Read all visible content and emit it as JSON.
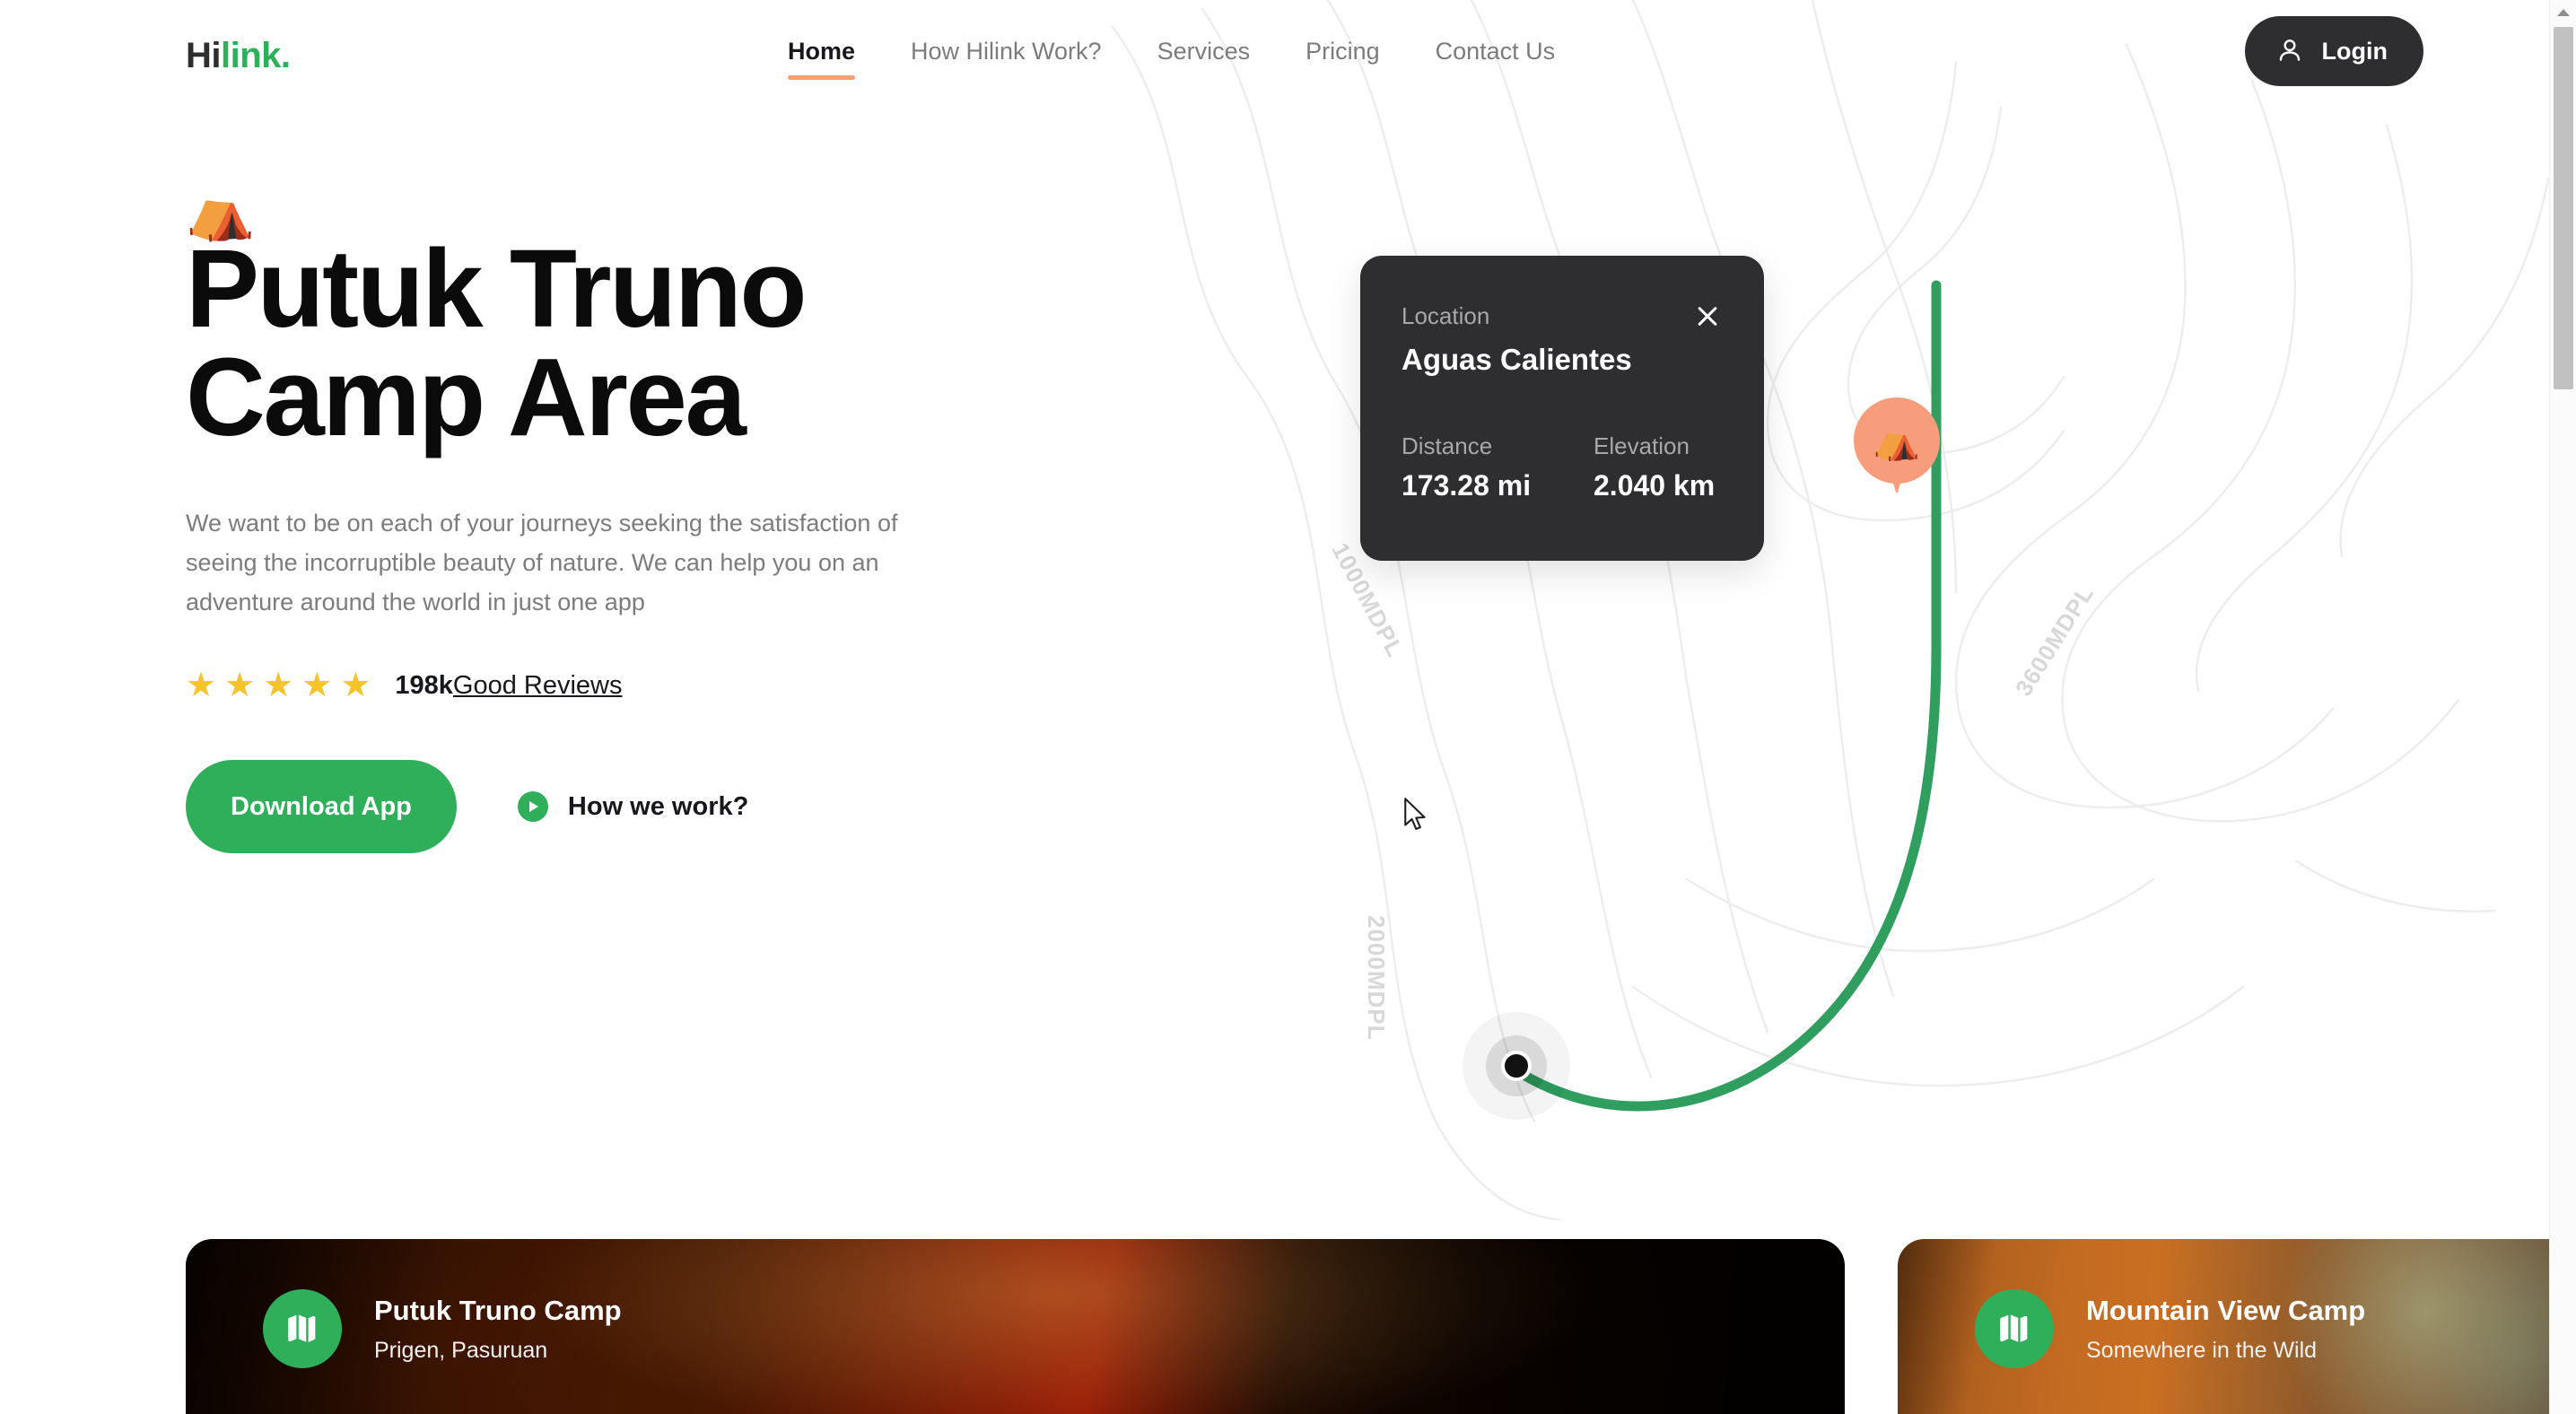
{
  "header": {
    "logo": {
      "part1": "Hi",
      "part2": "link."
    },
    "nav": [
      {
        "label": "Home",
        "active": true
      },
      {
        "label": "How Hilink Work?",
        "active": false
      },
      {
        "label": "Services",
        "active": false
      },
      {
        "label": "Pricing",
        "active": false
      },
      {
        "label": "Contact Us",
        "active": false
      }
    ],
    "login": {
      "label": "Login",
      "icon": "user-icon"
    }
  },
  "hero": {
    "badge_icon": "tent-emoji",
    "badge_glyph": "⛺",
    "title": "Putuk Truno\nCamp Area",
    "description": "We want to be on each of your journeys seeking the satisfaction of\nseeing the incorruptible beauty of nature. We can help you on an\nadventure around the world in just one app",
    "reviews": {
      "star_count": 5,
      "star_glyph": "★",
      "count": "198k",
      "label": "Good Reviews"
    },
    "cta": {
      "primary_label": "Download App",
      "secondary_label": "How we work?",
      "secondary_icon": "play-icon"
    }
  },
  "location_card": {
    "label": "Location",
    "name": "Aguas Calientes",
    "close_icon": "close-icon",
    "stats": [
      {
        "label": "Distance",
        "value": "173.28 mi"
      },
      {
        "label": "Elevation",
        "value": "2.040 km"
      }
    ]
  },
  "map": {
    "labels": [
      {
        "text": "1000MDPL",
        "name": "contour-label-1000"
      },
      {
        "text": "2000MDPL",
        "name": "contour-label-2000"
      },
      {
        "text": "3600MDPL",
        "name": "contour-label-3600"
      }
    ],
    "camp_marker_glyph": "⛺",
    "route_color": "#2f9e5f",
    "marker_color": "#f79d7c"
  },
  "camp_cards": [
    {
      "title": "Putuk Truno Camp",
      "subtitle": "Prigen, Pasuruan",
      "icon": "map-icon"
    },
    {
      "title": "Mountain View Camp",
      "subtitle": "Somewhere in the Wild",
      "icon": "map-icon"
    }
  ],
  "colors": {
    "brand_green": "#30af5b",
    "accent_orange": "#f7a072",
    "dark": "#2e2e30",
    "star_yellow": "#f5c42c"
  },
  "scrollbar": {
    "position": "top"
  }
}
